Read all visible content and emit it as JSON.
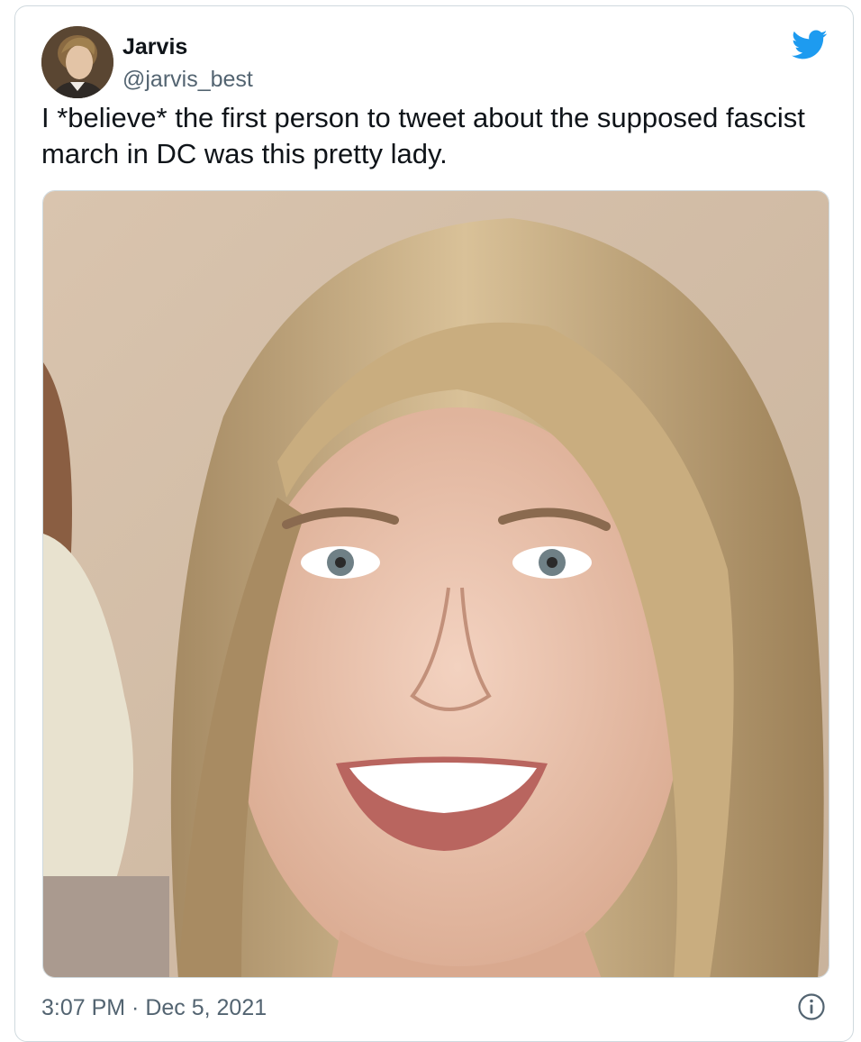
{
  "tweet": {
    "author": {
      "display_name": "Jarvis",
      "handle": "@jarvis_best",
      "avatar_icon": "portrait-avatar"
    },
    "text": "I *believe* the first person to tweet about the supposed fascist march in DC was this pretty lady.",
    "timestamp": "3:07 PM · Dec 5, 2021",
    "media": {
      "type": "photo",
      "description_icon": "portrait-photo"
    },
    "brand_icon": "twitter-bird-icon",
    "info_icon": "info-icon"
  },
  "colors": {
    "brand": "#1d9bf0",
    "text": "#0f1419",
    "secondary": "#536471",
    "border": "#cfd9de"
  }
}
